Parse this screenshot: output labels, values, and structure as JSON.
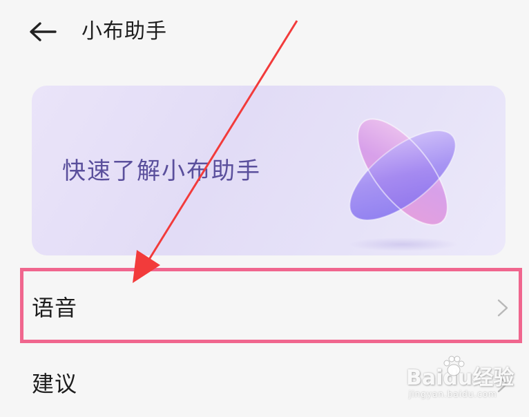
{
  "header": {
    "back_icon": "arrow-left-icon",
    "title": "小布助手"
  },
  "banner": {
    "title": "快速了解小布助手",
    "logo_icon": "xiaobu-logo-icon",
    "colors": {
      "title": "#5a4f9c",
      "background": "#e4def7"
    }
  },
  "list": {
    "items": [
      {
        "label": "语音",
        "chevron_icon": "chevron-right-icon"
      },
      {
        "label": "建议",
        "chevron_icon": "chevron-right-icon"
      }
    ]
  },
  "annotation": {
    "highlight_color": "#f0668e",
    "arrow_color": "#f23b3b"
  },
  "watermark": {
    "brand_a": "Bai",
    "brand_b": "du",
    "brand_c": "经验",
    "url": "jingyan.baidu.com"
  }
}
